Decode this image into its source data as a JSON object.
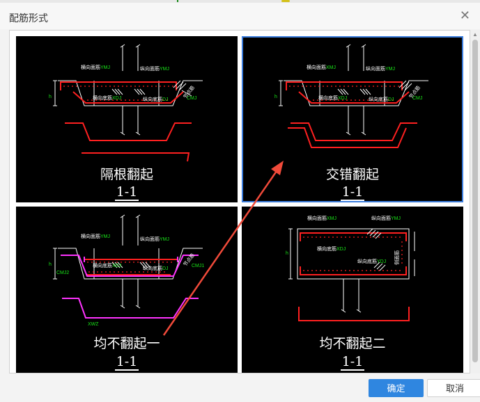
{
  "dialog": {
    "title": "配筋形式",
    "close_glyph": "✕"
  },
  "options": [
    {
      "caption": "隔根翻起",
      "section": "1-1",
      "labels": {
        "top_h": "横向面筋",
        "top_h_code": "YMJ",
        "top_v": "纵向面筋",
        "top_v_code": "YMJ",
        "bot_h": "横向底筋",
        "bot_h_code": "XDJ",
        "bot_v": "纵向底筋",
        "bot_v_code": "DJ",
        "cmj": "CMJ",
        "side": "节点筋",
        "h": "h"
      }
    },
    {
      "caption": "交错翻起",
      "section": "1-1",
      "selected": true,
      "labels": {
        "top_h": "横向面筋",
        "top_h_code": "XMJ",
        "top_v": "纵向面筋",
        "top_v_code": "YMJ",
        "bot_h": "横向底筋",
        "bot_h_code": "XDJ",
        "bot_v": "纵向底筋",
        "bot_v_code": "DJ",
        "cmj": "CMJ",
        "side": "节点筋",
        "h": "h"
      }
    },
    {
      "caption": "均不翻起一",
      "section": "1-1",
      "labels": {
        "top_h": "横向面筋",
        "top_h_code": "YMJ",
        "top_v": "纵向面筋",
        "top_v_code": "YMJ",
        "bot_h": "横向底筋",
        "bot_h_code": "XDJ",
        "bot_v": "纵向底筋",
        "bot_v_code": "DJ",
        "cmj": "CMJ1",
        "cmj2": "CMJ2",
        "side": "节点筋",
        "h": "h",
        "xwz": "XWZ"
      }
    },
    {
      "caption": "均不翻起二",
      "section": "1-1",
      "labels": {
        "top_h": "横向面筋",
        "top_h_code": "XMJ",
        "top_v": "纵向面筋",
        "top_v_code": "YMJ",
        "bot_h": "横向底筋",
        "bot_h_code": "XDJ",
        "bot_v": "纵向底筋",
        "bot_v_code": "YDJ",
        "side": "侧面筋",
        "h": "h"
      }
    }
  ],
  "buttons": {
    "ok": "确定",
    "cancel": "取消"
  },
  "colors": {
    "accent": "#2f86e0",
    "selection_border": "#3b7ddd",
    "rebar_red": "#ff2020",
    "dim_green": "#19e619",
    "magenta": "#ff33ff",
    "annotation_arrow": "#f04a3a"
  },
  "icons": [
    "close-icon",
    "scroll-up-arrow-icon",
    "annotation-arrow"
  ]
}
